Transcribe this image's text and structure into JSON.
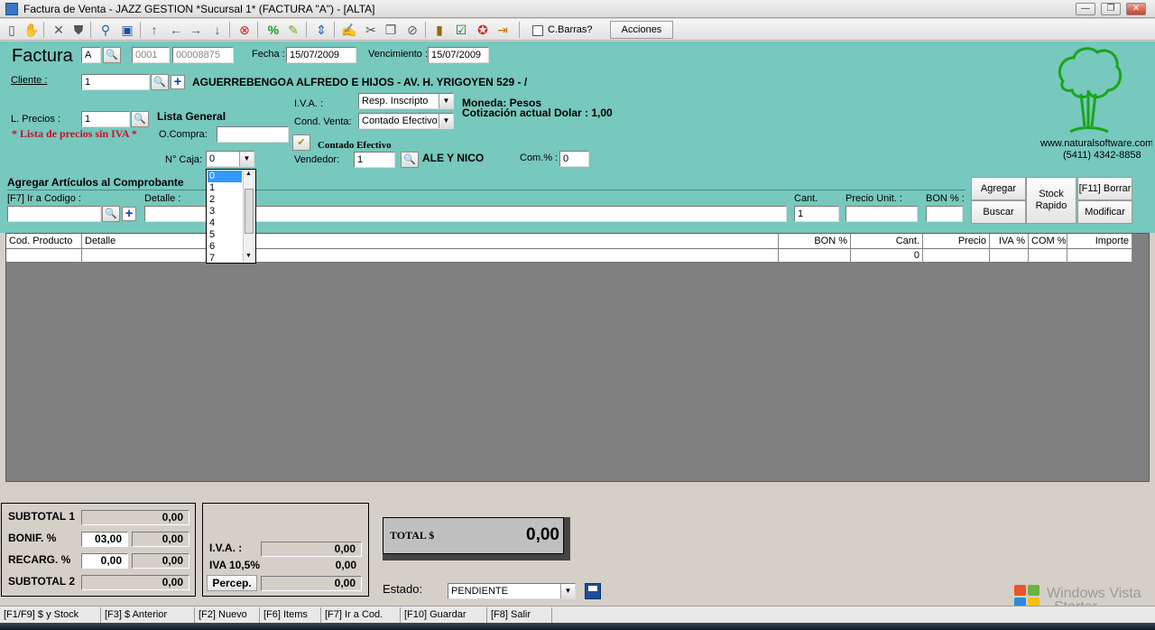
{
  "window": {
    "title": "Factura de Venta - JAZZ GESTION *Sucursal 1* (FACTURA \"A\") - [ALTA]",
    "min_glyph": "—",
    "max_glyph": "❐",
    "close_glyph": "✕"
  },
  "toolbar": {
    "barcode_label": "C.Barras?",
    "actions_label": "Acciones"
  },
  "invoice": {
    "heading": "Factura",
    "letter": "A",
    "branch_number": "0001",
    "invoice_number": "00008875",
    "date_label": "Fecha :",
    "date": "15/07/2009",
    "due_label": "Vencimiento :",
    "due_date": "15/07/2009"
  },
  "client": {
    "label": "Cliente :",
    "code": "1",
    "name": "AGUERREBENGOA ALFREDO E HIJOS - AV. H. YRIGOYEN 529 - /"
  },
  "tax": {
    "iva_label": "I.V.A. :",
    "iva_value": "Resp. Inscripto",
    "cond_label": "Cond. Venta:",
    "cond_value": "Contado Efectivo",
    "currency_text": "Moneda: Pesos",
    "rate_text": "Cotización actual Dolar : 1,00"
  },
  "prices": {
    "label": "L. Precios :",
    "code": "1",
    "list_name": "Lista General",
    "warning": "* Lista de precios sin IVA *"
  },
  "order": {
    "label": "O.Compra:",
    "value": "",
    "payment_caption": "Contado Efectivo"
  },
  "cashbox": {
    "label": "N° Caja:",
    "value": "0",
    "options": [
      "0",
      "1",
      "2",
      "3",
      "4",
      "5",
      "6",
      "7"
    ]
  },
  "seller": {
    "label": "Vendedor:",
    "code": "1",
    "name": "ALE Y NICO",
    "commission_label": "Com.% :",
    "commission": "0"
  },
  "logo": {
    "site": "www.naturalsoftware.com.ar",
    "phone": "(5411) 4342-8858"
  },
  "articles": {
    "section_title": "Agregar Artículos al Comprobante",
    "code_label": "[F7] Ir a Codigo :",
    "detail_label": "Detalle :",
    "qty_label": "Cant.",
    "qty_value": "1",
    "unit_price_label": "Precio Unit. :",
    "bon_label": "BON % :",
    "buttons": {
      "add": "Agregar",
      "search": "Buscar",
      "stock_line1": "Stock",
      "stock_line2": "Rapido",
      "delete": "[F11] Borrar",
      "modify": "Modificar"
    }
  },
  "grid": {
    "columns": [
      "Cod. Producto",
      "Detalle",
      "BON %",
      "Cant.",
      "Precio",
      "IVA %",
      "COM %",
      "Importe"
    ],
    "rows": [
      [
        "",
        "",
        "",
        "0",
        "",
        "",
        "",
        ""
      ]
    ]
  },
  "totals": {
    "subtotal1_label": "SUBTOTAL 1",
    "subtotal1": "0,00",
    "bonif_label": "BONIF. %",
    "bonif_pct": "03,00",
    "bonif_amount": "0,00",
    "recarg_label": "RECARG. %",
    "recarg_pct": "0,00",
    "recarg_amount": "0,00",
    "subtotal2_label": "SUBTOTAL 2",
    "subtotal2": "0,00",
    "iva_label": "I.V.A. :",
    "iva": "0,00",
    "iva105_label": "IVA 10,5%",
    "iva105": "0,00",
    "percep_label": "Percep.",
    "percep": "0,00",
    "total_label": "TOTAL $",
    "total": "0,00"
  },
  "status": {
    "label": "Estado:",
    "value": "PENDIENTE"
  },
  "statusbar": {
    "items": [
      "[F1/F9] $ y Stock",
      "[F3] $ Anterior",
      "[F2] Nuevo",
      "[F6] Items",
      "[F7] Ir a Cod.",
      "[F10] Guardar",
      "[F8] Salir"
    ]
  },
  "watermark": {
    "line1": "Windows Vista",
    "line2": "Starter"
  },
  "colors": {
    "form_bg": "#77c8bd",
    "grid_bg": "#808080",
    "warning": "#c8102e",
    "logo_green": "#1aa51a"
  }
}
